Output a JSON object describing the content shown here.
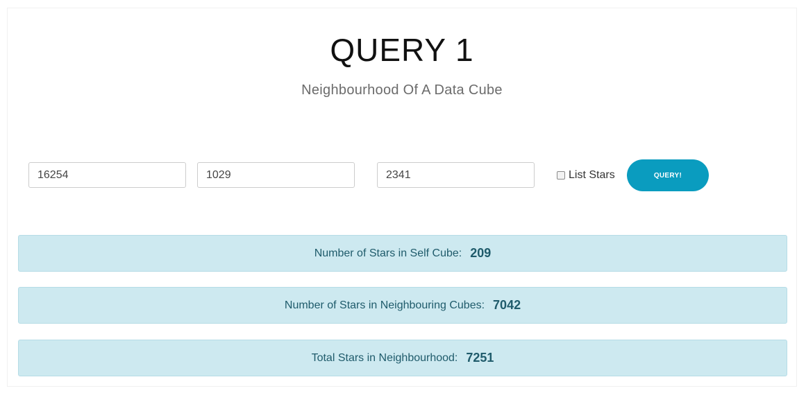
{
  "header": {
    "title": "QUERY 1",
    "subtitle": "Neighbourhood Of A Data Cube"
  },
  "form": {
    "x_value": "16254",
    "y_value": "1029",
    "z_value": "2341",
    "list_stars_label": "List Stars",
    "list_stars_checked": false,
    "query_button_label": "QUERY!"
  },
  "results": [
    {
      "label": "Number of Stars in Self Cube:",
      "value": "209"
    },
    {
      "label": "Number of Stars in Neighbouring Cubes:",
      "value": "7042"
    },
    {
      "label": "Total Stars in Neighbourhood:",
      "value": "7251"
    }
  ],
  "colors": {
    "accent": "#0a9cbf",
    "result_background": "#cde9f0",
    "result_text": "#1f5b6b"
  }
}
